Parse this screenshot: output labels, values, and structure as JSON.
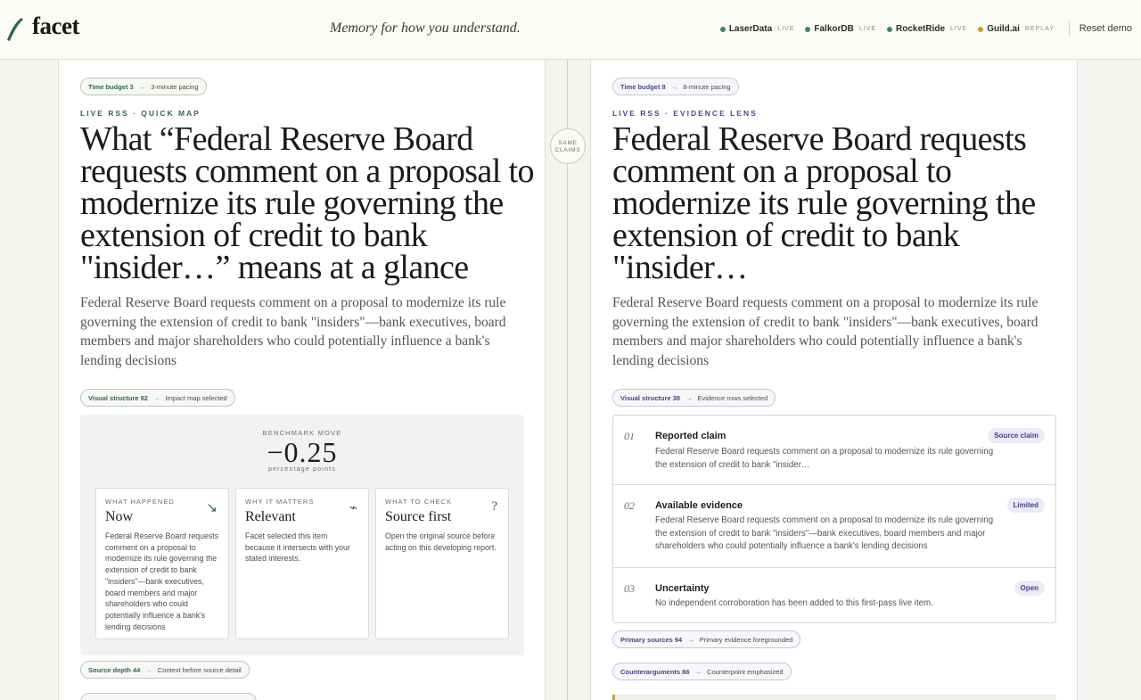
{
  "brand": {
    "name": "facet",
    "tagline": "Memory for how you understand."
  },
  "partners": [
    {
      "name": "LaserData",
      "status": "LIVE",
      "color": "#3b8a5a"
    },
    {
      "name": "FalkorDB",
      "status": "LIVE",
      "color": "#3b8a5a"
    },
    {
      "name": "RocketRide",
      "status": "LIVE",
      "color": "#3b8a5a"
    },
    {
      "name": "Guild.ai",
      "status": "REPLAY",
      "color": "#d39a2c"
    }
  ],
  "reset_label": "Reset demo",
  "center": {
    "line1": "SAME",
    "line2": "CLAIMS"
  },
  "left": {
    "chip_top": {
      "label": "Time budget 3",
      "detail": "3-minute pacing"
    },
    "eyebrow": "LIVE RSS · QUICK MAP",
    "headline": "What “Federal Reserve Board requests comment on a proposal to modernize its rule governing the extension of credit to bank \"insider…” means at a glance",
    "lede": "Federal Reserve Board requests comment on a proposal to modernize its rule governing the extension of credit to bank \"insiders\"—bank executives, board members and major shareholders who could potentially influence a bank's lending decisions",
    "chip_visual": {
      "label": "Visual structure 92",
      "detail": "Impact map selected"
    },
    "benchmark": {
      "label": "BENCHMARK MOVE",
      "value": "−0.25",
      "unit": "percentage points"
    },
    "cards": [
      {
        "label": "WHAT HAPPENED",
        "title": "Now",
        "icon": "↘",
        "body": "Federal Reserve Board requests comment on a proposal to modernize its rule governing the extension of credit to bank \"insiders\"—bank executives, board members and major shareholders who could potentially influence a bank's lending decisions"
      },
      {
        "label": "WHY IT MATTERS",
        "title": "Relevant",
        "icon": "⌁",
        "body": "Facet selected this item because it intersects with your stated interests."
      },
      {
        "label": "WHAT TO CHECK",
        "title": "Source first",
        "icon": "?",
        "body": "Open the original source before acting on this developing report."
      }
    ],
    "chip_source": {
      "label": "Source depth 44",
      "detail": "Context before source detail"
    }
  },
  "right": {
    "chip_top": {
      "label": "Time budget 8",
      "detail": "8-minute pacing"
    },
    "eyebrow": "LIVE RSS · EVIDENCE LENS",
    "headline": "Federal Reserve Board requests comment on a proposal to modernize its rule governing the extension of credit to bank \"insider…",
    "lede": "Federal Reserve Board requests comment on a proposal to modernize its rule governing the extension of credit to bank \"insiders\"—bank executives, board members and major shareholders who could potentially influence a bank's lending decisions",
    "chip_visual": {
      "label": "Visual structure 38",
      "detail": "Evidence rows selected"
    },
    "rows": [
      {
        "num": "01",
        "title": "Reported claim",
        "badge": "Source claim",
        "body": "Federal Reserve Board requests comment on a proposal to modernize its rule governing the extension of credit to bank \"insider…"
      },
      {
        "num": "02",
        "title": "Available evidence",
        "badge": "Limited",
        "body": "Federal Reserve Board requests comment on a proposal to modernize its rule governing the extension of credit to bank \"insiders\"—bank executives, board members and major shareholders who could potentially influence a bank's lending decisions"
      },
      {
        "num": "03",
        "title": "Uncertainty",
        "badge": "Open",
        "body": "No independent corroboration has been added to this first-pass live item."
      }
    ],
    "chip_primary": {
      "label": "Primary sources 94",
      "detail": "Primary evidence foregrounded"
    },
    "chip_counter": {
      "label": "Counterarguments 86",
      "detail": "Counterpoint emphasized"
    }
  }
}
